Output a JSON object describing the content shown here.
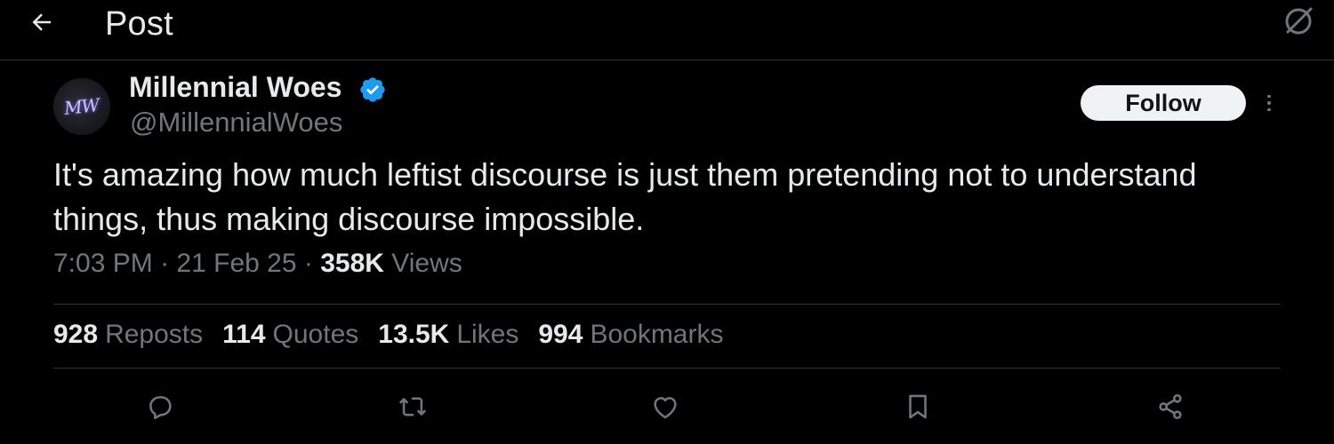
{
  "header": {
    "title": "Post",
    "back_icon": "arrow-left-icon",
    "right_icon": "circle-slash-icon"
  },
  "author": {
    "display_name": "Millennial Woes",
    "handle": "@MillennialWoes",
    "avatar_text": "MW",
    "verified": true,
    "verified_color": "#1d9bf0"
  },
  "follow_label": "Follow",
  "tweet": {
    "text": "It's amazing how much leftist discourse is just them pretending not to understand things, thus making discourse impossible."
  },
  "meta": {
    "time": "7:03 PM",
    "date": "21 Feb 25",
    "separator": "·",
    "views_count": "358K",
    "views_label": "Views"
  },
  "stats": [
    {
      "num": "928",
      "label": "Reposts"
    },
    {
      "num": "114",
      "label": "Quotes"
    },
    {
      "num": "13.5K",
      "label": "Likes"
    },
    {
      "num": "994",
      "label": "Bookmarks"
    }
  ],
  "actions": [
    "reply-icon",
    "repost-icon",
    "like-icon",
    "bookmark-icon",
    "share-icon"
  ],
  "colors": {
    "background": "#000000",
    "text_primary": "#e7e9ea",
    "text_secondary": "#71767b",
    "border": "#2f3336",
    "follow_bg": "#eff3f4"
  }
}
